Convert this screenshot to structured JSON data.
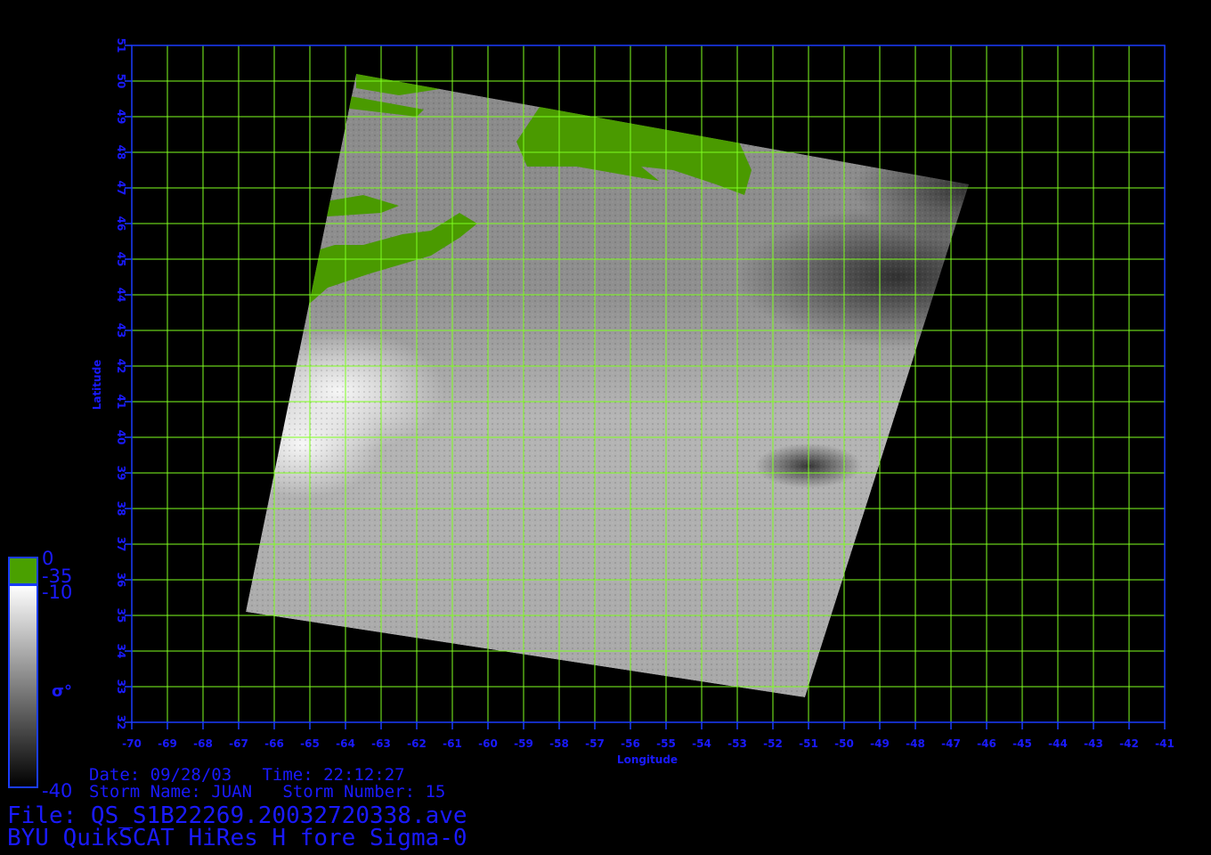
{
  "title": "BYU QuikSCAT HiRes H fore Sigma-0",
  "file_line": "File: QS_S1B22269.20032720338.ave",
  "date_line": "Date: 09/28/03   Time: 22:12:27",
  "storm_line": "Storm Name: JUAN   Storm Number: 15",
  "map": {
    "xlabel": "Longitude",
    "ylabel": "Latitude",
    "lon_range": [
      -70,
      -41
    ],
    "lat_range": [
      32,
      51
    ],
    "lon_ticks": [
      "-70",
      "-69",
      "-68",
      "-67",
      "-66",
      "-65",
      "-64",
      "-63",
      "-62",
      "-61",
      "-60",
      "-59",
      "-58",
      "-57",
      "-56",
      "-55",
      "-54",
      "-53",
      "-52",
      "-51",
      "-50",
      "-49",
      "-48",
      "-47",
      "-46",
      "-45",
      "-44",
      "-43",
      "-42",
      "-41"
    ],
    "lat_ticks": [
      "32",
      "33",
      "34",
      "35",
      "36",
      "37",
      "38",
      "39",
      "40",
      "41",
      "42",
      "43",
      "44",
      "45",
      "46",
      "47",
      "48",
      "49",
      "50",
      "51"
    ],
    "grid": true,
    "grid_color": "#7fff1f",
    "frame_color": "#1a3cff",
    "land_color": "#4a9a00",
    "swath_corners_lonlat": [
      [
        -63.7,
        50.2
      ],
      [
        -46.5,
        47.1
      ],
      [
        -51.1,
        32.7
      ],
      [
        -66.8,
        35.1
      ]
    ]
  },
  "colorbar": {
    "symbol": "σ°",
    "land_top_label": "0",
    "land_bottom_label": "-35",
    "sigma_top_label": "-10",
    "sigma_bottom_label": "-40",
    "land_color": "#4aa000",
    "gradient_top": "#ffffff",
    "gradient_bottom": "#000000"
  }
}
